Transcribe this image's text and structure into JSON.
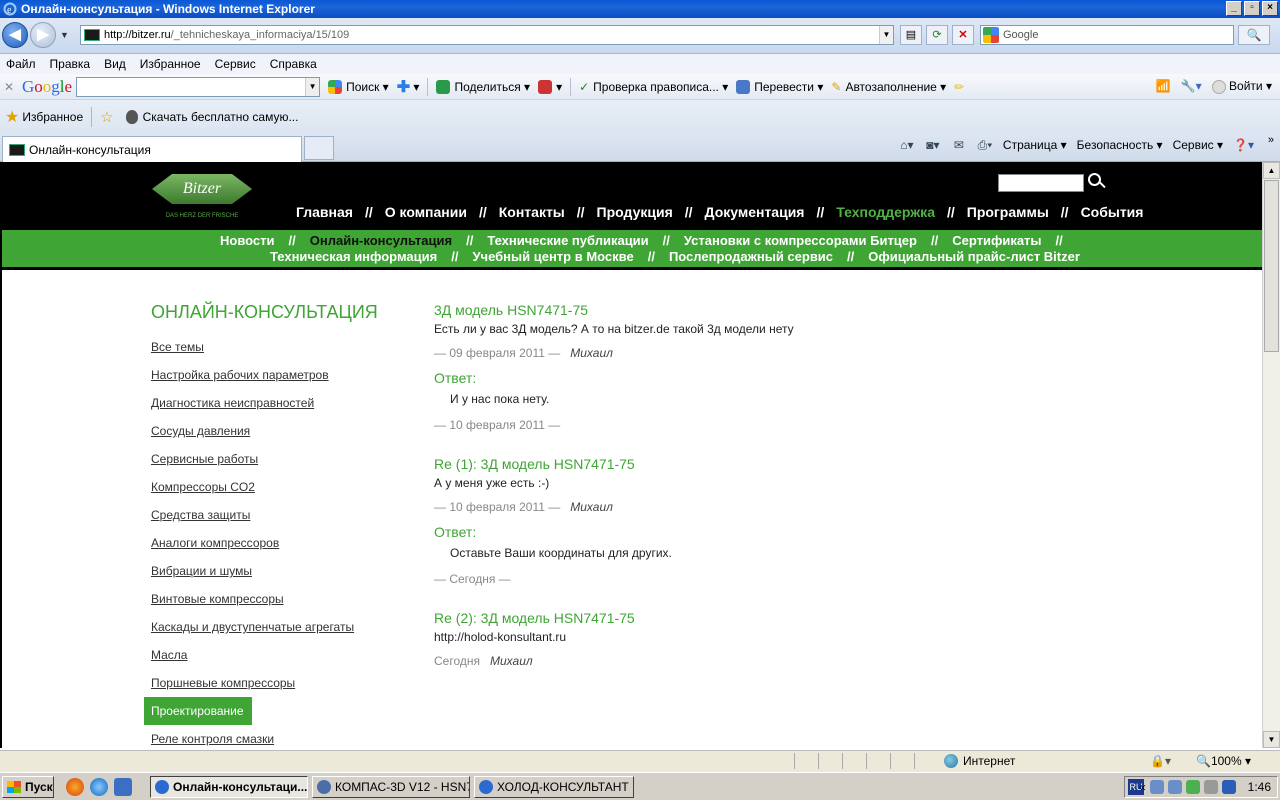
{
  "window": {
    "title": "Онлайн-консультация - Windows Internet Explorer",
    "buttons": [
      "_",
      "▫",
      "×"
    ]
  },
  "address": {
    "url_prefix": "http://bitzer.ru",
    "url_rest": "/_tehnicheskaya_informaciya/15/109",
    "search_placeholder": "Google"
  },
  "menu": [
    "Файл",
    "Правка",
    "Вид",
    "Избранное",
    "Сервис",
    "Справка"
  ],
  "google_toolbar": {
    "logo": "Google",
    "search": "Поиск",
    "share": "Поделиться",
    "spellcheck": "Проверка правописа...",
    "translate": "Перевести",
    "autofill": "Автозаполнение",
    "signin": "Войти"
  },
  "favorites": {
    "label": "Избранное",
    "item": "Скачать бесплатно самую..."
  },
  "tabs": {
    "active": "Онлайн-консультация",
    "commands": [
      "Страница",
      "Безопасность",
      "Сервис"
    ]
  },
  "site": {
    "logo_text": "Bitzer",
    "logo_tag": "DAS HERZ DER FRISCHE",
    "main_nav": [
      {
        "label": "Главная",
        "active": false
      },
      {
        "label": "О компании",
        "active": false
      },
      {
        "label": "Контакты",
        "active": false
      },
      {
        "label": "Продукция",
        "active": false
      },
      {
        "label": "Документация",
        "active": false
      },
      {
        "label": "Техподдержка",
        "active": true
      },
      {
        "label": "Программы",
        "active": false
      },
      {
        "label": "События",
        "active": false
      }
    ],
    "separator": "//",
    "sub_nav_line1": [
      "Новости",
      "Онлайн-консультация",
      "Технические публикации",
      "Установки с компрессорами Битцер",
      "Сертификаты"
    ],
    "sub_nav_line2": [
      "Техническая информация",
      "Учебный центр в Москве",
      "Послепродажный сервис",
      "Официальный прайс-лист Bitzer"
    ],
    "sidebar_title": "ОНЛАЙН-КОНСУЛЬТАЦИЯ",
    "sidebar": [
      "Все темы",
      "Настройка рабочих параметров",
      "Диагностика неисправностей",
      "Сосуды давления",
      "Сервисные работы",
      "Компрессоры CO2",
      "Средства защиты",
      "Аналоги компрессоров",
      "Вибрации и шумы",
      "Винтовые компрессоры",
      "Каскады и двуступенчатые агрегаты",
      "Масла",
      "Поршневые компрессоры",
      "Проектирование",
      "Реле контроля смазки"
    ],
    "sidebar_active_index": 13,
    "posts": [
      {
        "title": "3Д модель HSN7471-75",
        "text": "Есть ли у вас 3Д модель? А то на bitzer.de такой 3д модели нету",
        "date": "— 09 февраля 2011 —",
        "author": "Михаил",
        "answer_label": "Ответ:",
        "answer": "И у нас пока нету.",
        "answer_date": "— 10 февраля 2011 —"
      },
      {
        "title": "Re (1): 3Д модель HSN7471-75",
        "text": "А у меня уже есть :-)",
        "date": "— 10 февраля 2011 —",
        "author": "Михаил",
        "answer_label": "Ответ:",
        "answer": "Оставьте Ваши координаты для других.",
        "answer_date": "— Сегодня —"
      },
      {
        "title": "Re (2): 3Д модель HSN7471-75",
        "text": "http://holod-konsultant.ru",
        "date": "Сегодня",
        "author": "Михаил"
      }
    ]
  },
  "status": {
    "zone": "Интернет",
    "zoom": "100%"
  },
  "taskbar": {
    "start": "Пуск",
    "tasks": [
      "Онлайн-консультаци...",
      "КОМПАС-3D V12 - HSN7...",
      "ХОЛОД-КОНСУЛЬТАНТ ..."
    ],
    "lang": "RU",
    "clock": "1:46"
  }
}
